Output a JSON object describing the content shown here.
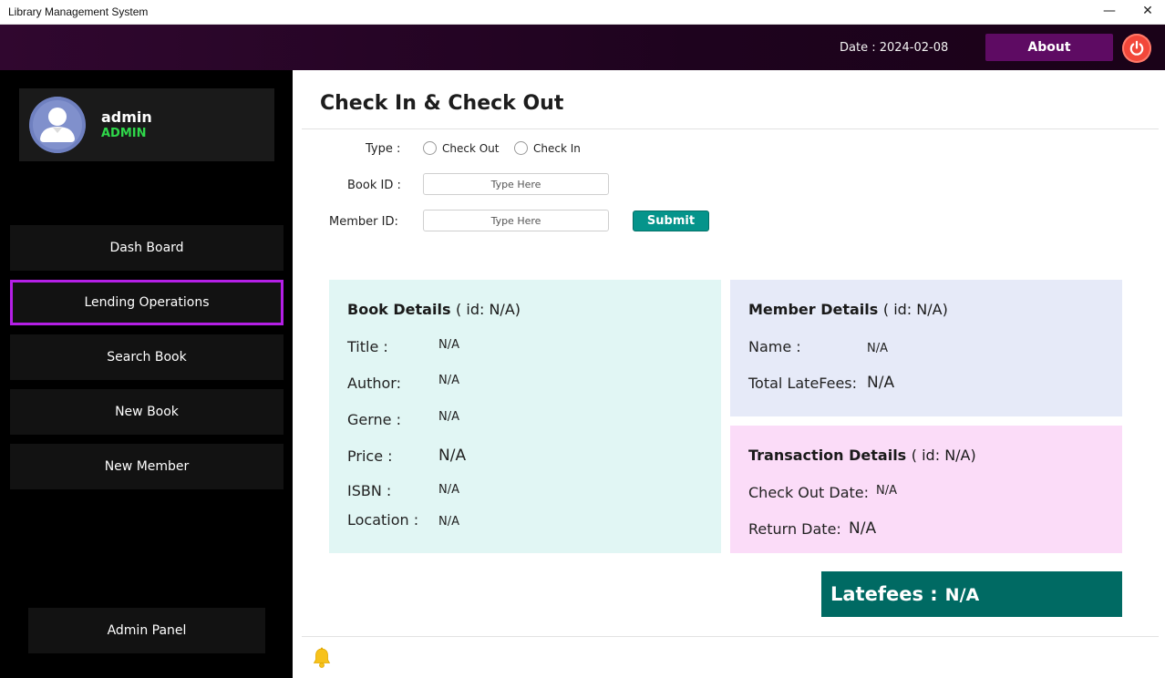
{
  "window": {
    "title": "Library Management System",
    "minimize_glyph": "—",
    "close_glyph": "✕"
  },
  "topbar": {
    "date_label": "Date : 2024-02-08",
    "about_label": "About",
    "power_icon": "power-icon",
    "power_color": "#f2473a"
  },
  "sidebar": {
    "user": {
      "name": "admin",
      "role": "ADMIN",
      "role_color": "#2fd84a",
      "avatar_icon": "user-avatar-icon"
    },
    "items": [
      {
        "label": "Dash Board"
      },
      {
        "label": "Lending Operations"
      },
      {
        "label": "Search Book"
      },
      {
        "label": "New Book"
      },
      {
        "label": "New Member"
      }
    ],
    "active_index": 1,
    "active_color": "#b41fe6",
    "admin_panel_label": "Admin Panel"
  },
  "main": {
    "title": "Check In & Check Out",
    "form": {
      "type_label": "Type :",
      "options": [
        {
          "label": "Check Out"
        },
        {
          "label": "Check In"
        }
      ],
      "book_id_label": "Book ID :",
      "book_id_placeholder": "Type Here",
      "member_id_label": "Member ID:",
      "member_id_placeholder": "Type Here",
      "submit_label": "Submit",
      "submit_color": "#05948b"
    },
    "book": {
      "heading": "Book Details",
      "id_text": "( id: N/A)",
      "title_label": "Title :",
      "title_value": "N/A",
      "author_label": "Author:",
      "author_value": "N/A",
      "genre_label": "Gerne :",
      "genre_value": "N/A",
      "price_label": "Price :",
      "price_value": "N/A",
      "isbn_label": "ISBN :",
      "isbn_value": "N/A",
      "location_label": "Location :",
      "location_value": "N/A",
      "bg_color": "#e1f6f4"
    },
    "member": {
      "heading": "Member Details",
      "id_text": "( id: N/A)",
      "name_label": "Name :",
      "name_value": "N/A",
      "latefees_label": "Total LateFees:",
      "latefees_value": "N/A",
      "bg_color": "#e6eaf8"
    },
    "transaction": {
      "heading": "Transaction Details",
      "id_text": "( id: N/A)",
      "checkout_label": "Check Out Date:",
      "checkout_value": "N/A",
      "return_label": "Return Date:",
      "return_value": "N/A",
      "bg_color": "#fbdcf8"
    },
    "latefees": {
      "label": "Latefees :",
      "value": "N/A",
      "bg_color": "#006a63"
    },
    "notification_icon": "bell-icon"
  }
}
